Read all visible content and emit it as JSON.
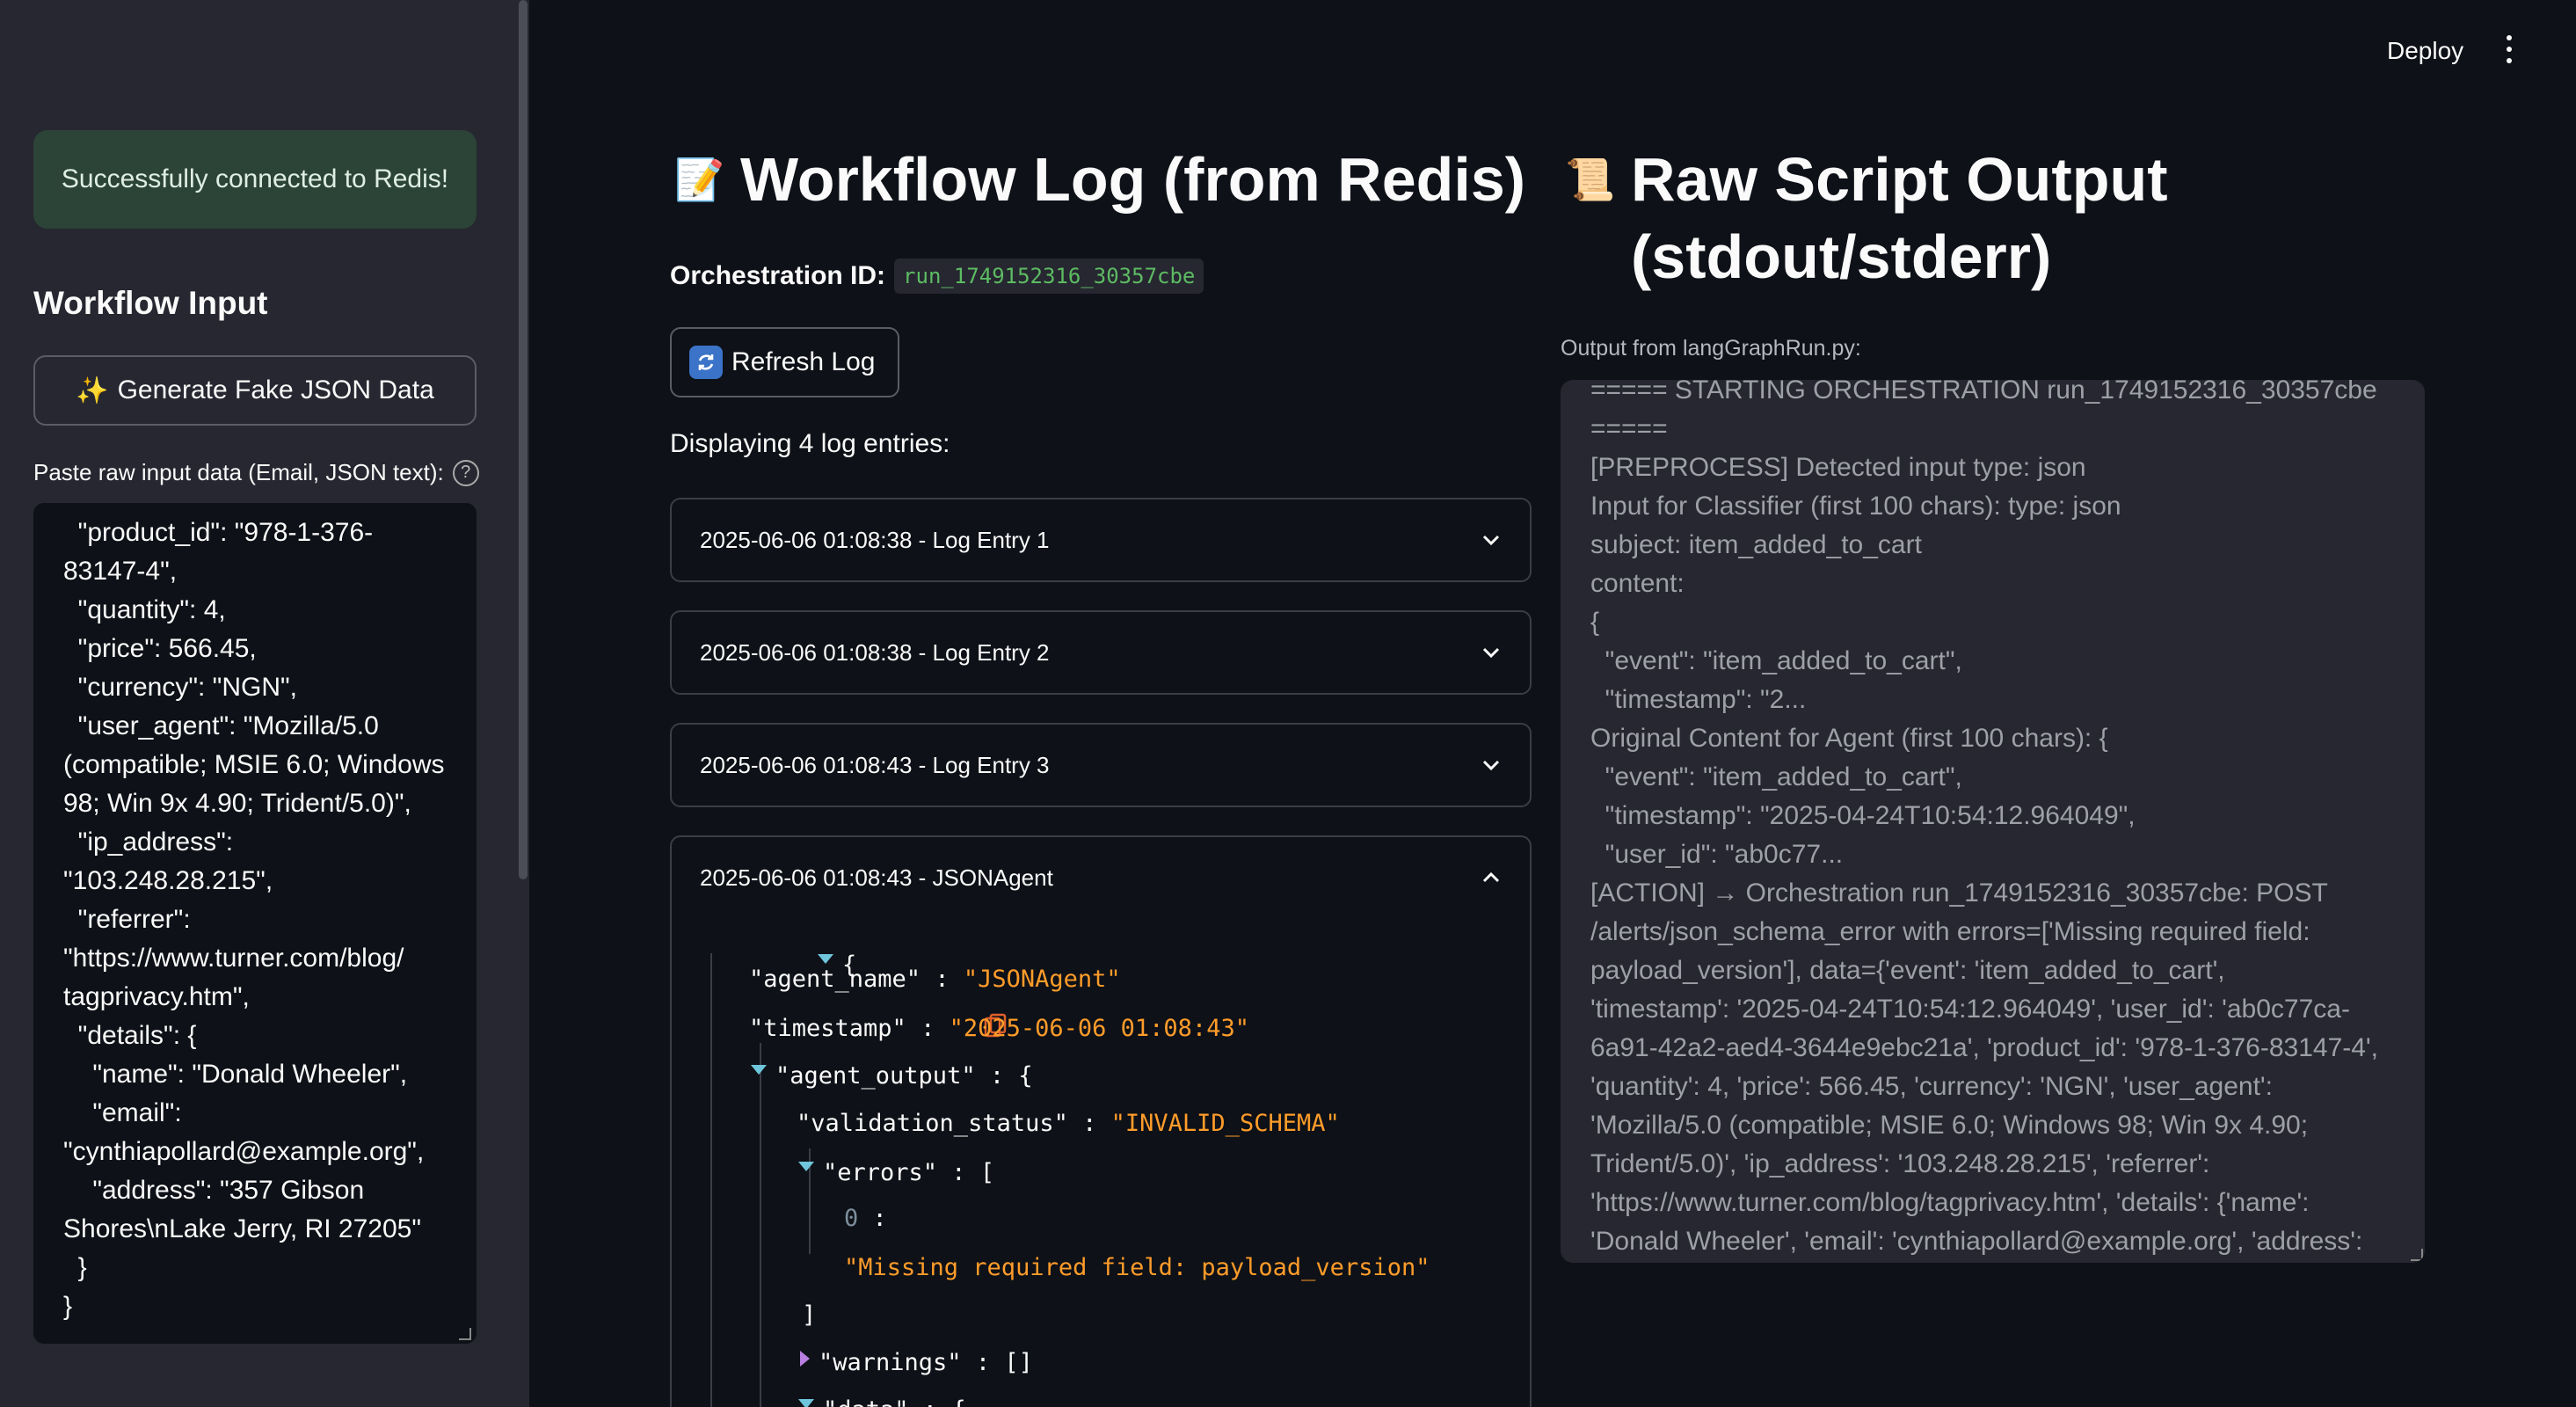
{
  "header": {
    "deploy": "Deploy"
  },
  "sidebar": {
    "alert": "Successfully connected to Redis!",
    "section_title": "Workflow Input",
    "fake_button": {
      "emoji": "✨",
      "label": "Generate Fake JSON Data"
    },
    "paste_label": "Paste raw input data (Email, JSON text):",
    "help_icon": "?",
    "input_value": "  \"product_id\": \"978-1-376-\n83147-4\",\n  \"quantity\": 4,\n  \"price\": 566.45,\n  \"currency\": \"NGN\",\n  \"user_agent\": \"Mozilla/5.0\n(compatible; MSIE 6.0; Windows\n98; Win 9x 4.90; Trident/5.0)\",\n  \"ip_address\":\n\"103.248.28.215\",\n  \"referrer\":\n\"https://www.turner.com/blog/\ntagprivacy.htm\",\n  \"details\": {\n    \"name\": \"Donald Wheeler\",\n    \"email\":\n\"cynthiapollard@example.org\",\n    \"address\": \"357 Gibson\nShores\\nLake Jerry, RI 27205\"\n  }\n}"
  },
  "main": {
    "title_emoji": "📝",
    "title": "Workflow Log (from Redis)",
    "orch_label": "Orchestration ID:",
    "orch_id": "run_1749152316_30357cbe",
    "refresh_emoji": "🔄",
    "refresh_label": "Refresh Log",
    "displaying": "Displaying 4 log entries:",
    "entries": [
      {
        "label": "2025-06-06 01:08:38 - Log Entry 1"
      },
      {
        "label": "2025-06-06 01:08:38 - Log Entry 2"
      },
      {
        "label": "2025-06-06 01:08:43 - Log Entry 3"
      },
      {
        "label": "2025-06-06 01:08:43 - JSONAgent"
      }
    ],
    "json": {
      "open_brace": "{",
      "agent_name_key": "\"agent_name\"",
      "agent_name_val": "\"JSONAgent\"",
      "timestamp_key": "\"timestamp\"",
      "timestamp_val": "\"2025-06-06 01:08:43\"",
      "agent_output_key": "\"agent_output\"",
      "validation_key": "\"validation_status\"",
      "validation_val": "\"INVALID_SCHEMA\"",
      "errors_key": "\"errors\"",
      "errors_0_index": "0",
      "errors_0_val": "\"Missing required field: payload_version\"",
      "close_bracket": "]",
      "warnings_key": "\"warnings\"",
      "warnings_val": "[]",
      "data_key": "\"data\""
    }
  },
  "right": {
    "title_emoji": "📜",
    "title": "Raw Script Output (stdout/stderr)",
    "output_label": "Output from langGraphRun.py:",
    "output_text": "===== STARTING ORCHESTRATION run_1749152316_30357cbe\n=====\n[PREPROCESS] Detected input type: json\nInput for Classifier (first 100 chars): type: json\nsubject: item_added_to_cart\ncontent:\n{\n  \"event\": \"item_added_to_cart\",\n  \"timestamp\": \"2...\nOriginal Content for Agent (first 100 chars): {\n  \"event\": \"item_added_to_cart\",\n  \"timestamp\": \"2025-04-24T10:54:12.964049\",\n  \"user_id\": \"ab0c77...\n[ACTION] → Orchestration run_1749152316_30357cbe: POST\n/alerts/json_schema_error with errors=['Missing required field:\npayload_version'], data={'event': 'item_added_to_cart',\n'timestamp': '2025-04-24T10:54:12.964049', 'user_id': 'ab0c77ca-\n6a91-42a2-aed4-3644e9ebc21a', 'product_id': '978-1-376-83147-4',\n'quantity': 4, 'price': 566.45, 'currency': 'NGN', 'user_agent':\n'Mozilla/5.0 (compatible; MSIE 6.0; Windows 98; Win 9x 4.90;\nTrident/5.0)', 'ip_address': '103.248.28.215', 'referrer':\n'https://www.turner.com/blog/tagprivacy.htm', 'details': {'name':\n'Donald Wheeler', 'email': 'cynthiapollard@example.org', 'address':"
  },
  "colors": {
    "background": "#0e1117",
    "sidebar": "#262730",
    "success_alert": "#2c4437",
    "json_string": "#ff9c2a",
    "code_green": "#5dbb63"
  },
  "icons": [
    "help-icon",
    "chevron-down-icon",
    "chevron-up-icon",
    "copy-icon",
    "menu-icon",
    "refresh-icon"
  ]
}
